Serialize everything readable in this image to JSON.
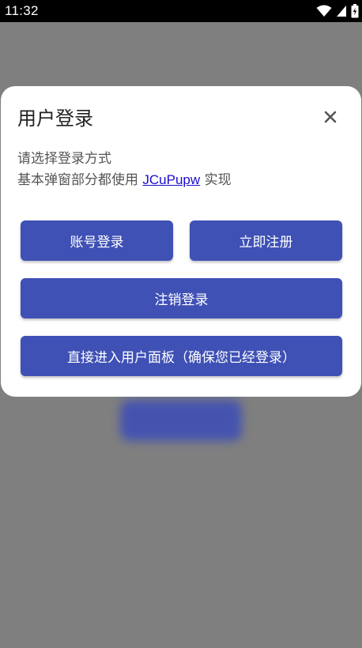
{
  "status_bar": {
    "time": "11:32",
    "icons": [
      "wifi-icon",
      "cell-signal-icon",
      "battery-icon"
    ]
  },
  "dialog": {
    "title": "用户登录",
    "close_icon": "close-icon",
    "description_line1": "请选择登录方式",
    "description_line2_prefix": "基本弹窗部分都使用 ",
    "description_link": "JCuPupw",
    "description_line2_suffix": " 实现",
    "buttons": {
      "account_login": "账号登录",
      "register_now": "立即注册",
      "logout": "注销登录",
      "enter_user_panel": "直接进入用户面板（确保您已经登录）"
    }
  },
  "colors": {
    "overlay": "#7f7f7f",
    "primary": "#3f51b5",
    "link": "#1a0dcc",
    "dialog_bg": "#ffffff"
  }
}
